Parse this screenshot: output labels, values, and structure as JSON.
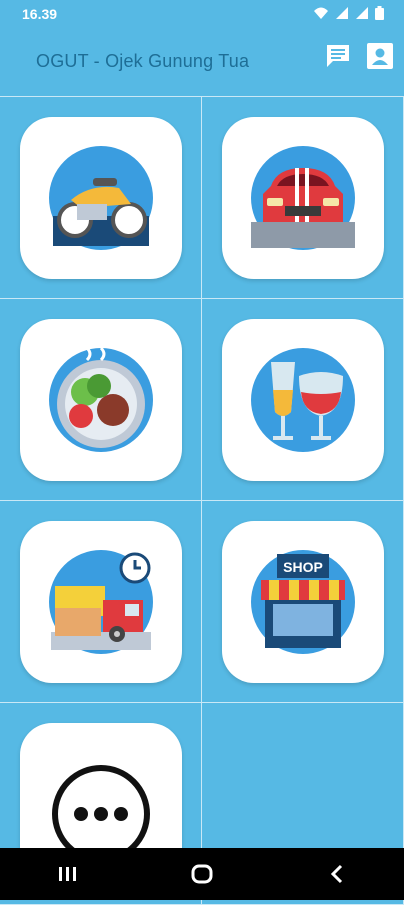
{
  "status": {
    "time": "16.39",
    "icons": [
      "wifi-icon",
      "signal-icon",
      "signal-icon",
      "battery-icon"
    ]
  },
  "app_bar": {
    "title": "OGUT - Ojek Gunung Tua",
    "actions": [
      "chat-icon",
      "profile-icon"
    ]
  },
  "services": [
    {
      "icon": "motorbike-icon"
    },
    {
      "icon": "car-icon"
    },
    {
      "icon": "food-icon"
    },
    {
      "icon": "drink-icon"
    },
    {
      "icon": "delivery-truck-icon"
    },
    {
      "icon": "shop-icon"
    },
    {
      "icon": "more-icon"
    }
  ],
  "shop_sign": "SHOP",
  "nav_bar": [
    "recent-apps-icon",
    "home-icon",
    "back-icon"
  ],
  "colors": {
    "background": "#56b9e4",
    "title": "#1e6e96",
    "icon_circle": "#3a9de0"
  }
}
